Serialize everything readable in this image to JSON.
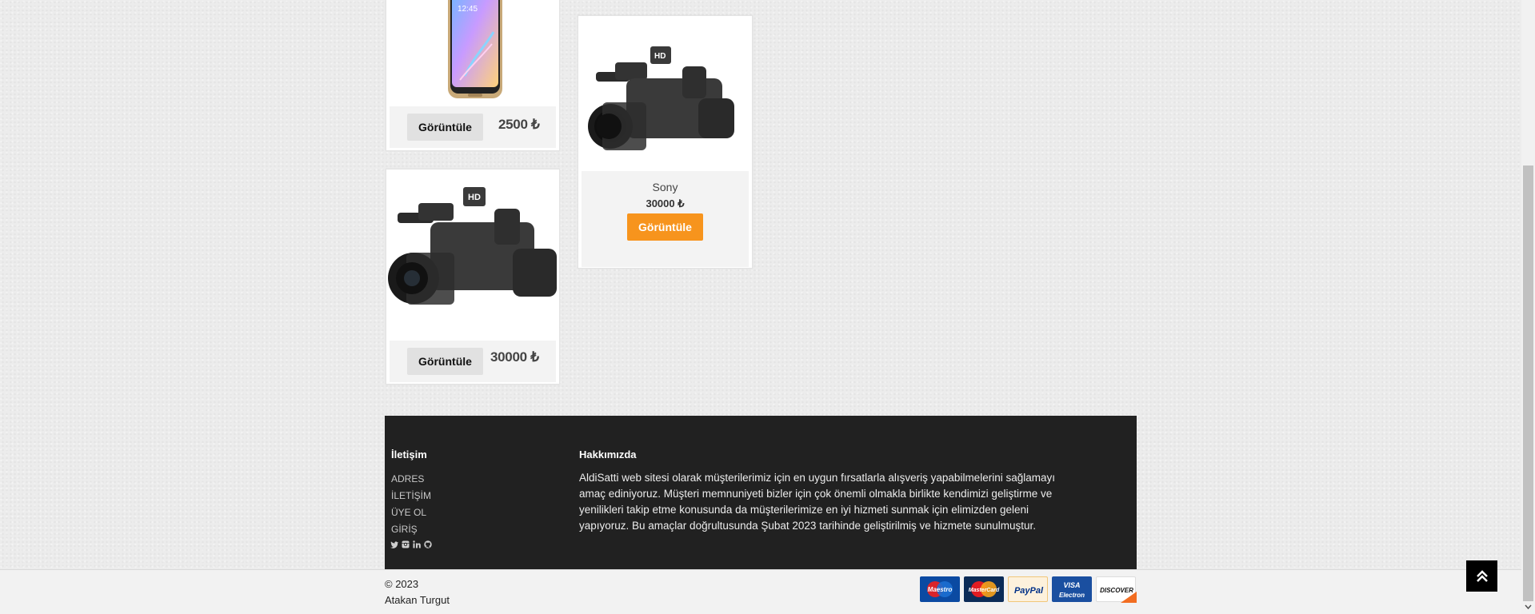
{
  "products": [
    {
      "view_label": "Görüntüle",
      "price": "2500 ₺"
    },
    {
      "name": "Sony",
      "price": "30000 ₺",
      "view_label": "Görüntüle"
    },
    {
      "view_label": "Görüntüle",
      "price": "30000 ₺"
    }
  ],
  "footer": {
    "contact_heading": "İletişim",
    "links": [
      "ADRES",
      "İLETİŞİM",
      "ÜYE OL",
      "GİRİŞ"
    ],
    "about_heading": "Hakkımızda",
    "about_text": "AldiSatti web sitesi olarak müşterilerimiz için en uygun fırsatlarla alışveriş yapabilmelerini sağlamayı amaç ediniyoruz. Müşteri memnuniyeti bizler için çok önemli olmakla birlikte kendimizi geliştirme ve yenilikleri takip etme konusunda da müşterilerimize en iyi hizmeti sunmak için elimizden geleni yapıyoruz. Bu amaçlar doğrultusunda Şubat 2023 tarihinde geliştirilmiş ve hizmete sunulmuştur.",
    "social_icons": [
      "twitter-icon",
      "instagram-icon",
      "linkedin-icon",
      "github-icon"
    ],
    "copyright_year": "© 2023",
    "copyright_name": "Atakan Turgut",
    "payment_methods": [
      "Maestro",
      "MasterCard",
      "PayPal",
      "VISA Electron",
      "DISCOVER"
    ]
  },
  "accent_color": "#f7941d"
}
